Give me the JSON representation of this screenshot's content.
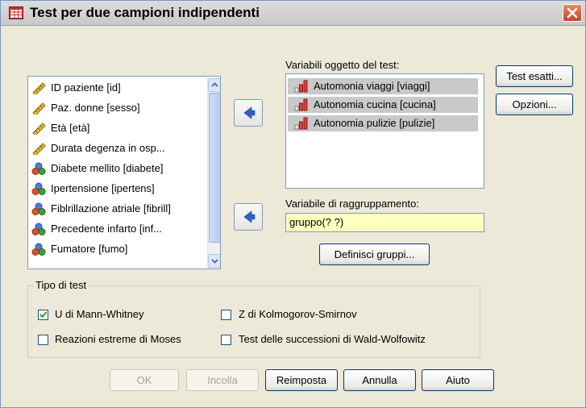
{
  "window": {
    "title": "Test per due campioni indipendenti"
  },
  "source_list": {
    "items": [
      {
        "label": "ID paziente [id]",
        "icon": "scale-ruler-icon"
      },
      {
        "label": "Paz. donne [sesso]",
        "icon": "ruler-icon"
      },
      {
        "label": "Età [età]",
        "icon": "ruler-icon"
      },
      {
        "label": "Durata degenza in osp...",
        "icon": "ruler-icon"
      },
      {
        "label": "Diabete mellito [diabete]",
        "icon": "nominal-icon"
      },
      {
        "label": "Ipertensione [ipertens]",
        "icon": "nominal-icon"
      },
      {
        "label": "Fiblrillazione atriale [fibrill]",
        "icon": "nominal-icon"
      },
      {
        "label": "Precedente infarto [inf...",
        "icon": "nominal-icon"
      },
      {
        "label": "Fumatore [fumo]",
        "icon": "nominal-icon"
      }
    ]
  },
  "test_vars": {
    "label": "Variabili oggetto del test:",
    "items": [
      {
        "label": "Automonia viaggi [viaggi]",
        "icon": "ordinal-icon"
      },
      {
        "label": "Autonomia cucina [cucina]",
        "icon": "ordinal-icon"
      },
      {
        "label": "Autonomia pulizie [pulizie]",
        "icon": "ordinal-icon"
      }
    ]
  },
  "grouping": {
    "label": "Variabile di raggruppamento:",
    "value": "gruppo(? ?)",
    "define_button": "Definisci gruppi..."
  },
  "side_buttons": {
    "exact": "Test esatti...",
    "options": "Opzioni..."
  },
  "test_type": {
    "title": "Tipo di test",
    "options": [
      {
        "label": "U di Mann-Whitney",
        "checked": true
      },
      {
        "label": "Z di Kolmogorov-Smirnov",
        "checked": false
      },
      {
        "label": "Reazioni estreme di Moses",
        "checked": false
      },
      {
        "label": "Test delle successioni di Wald-Wolfowitz",
        "checked": false
      }
    ]
  },
  "bottom_buttons": {
    "ok": "OK",
    "paste": "Incolla",
    "reset": "Reimposta",
    "cancel": "Annulla",
    "help": "Aiuto"
  },
  "colors": {
    "dialog_bg": "#ece9d8",
    "field_yellow": "#ffffc0",
    "selection_gray": "#c9c9c9",
    "accent_blue": "#3a6fc8"
  }
}
